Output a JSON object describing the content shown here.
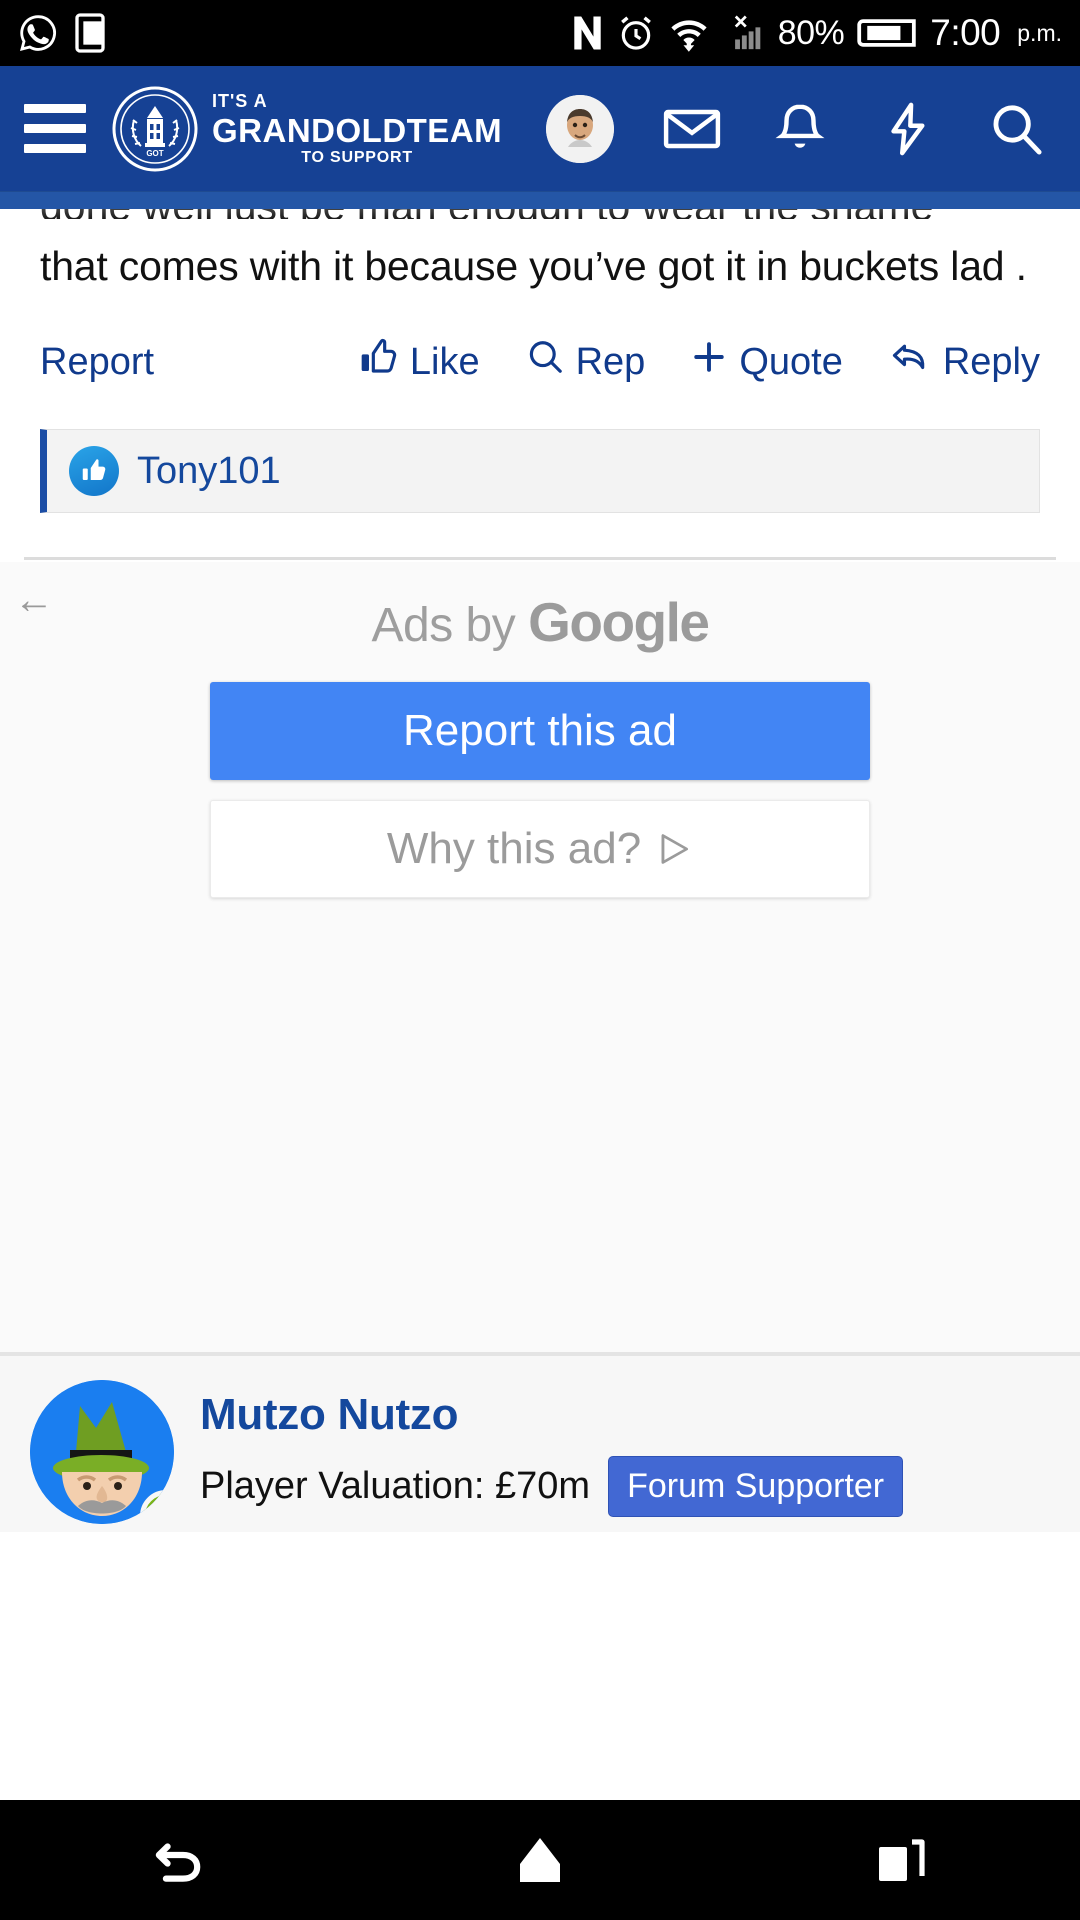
{
  "status_bar": {
    "left_icons": [
      "whatsapp-icon",
      "sim-card-icon"
    ],
    "right_icons": [
      "nfc-icon",
      "alarm-icon",
      "wifi-icon",
      "signal-icon"
    ],
    "battery_percent": "80%",
    "battery_icon": "battery-icon",
    "time": "7:00",
    "meridiem": "p.m."
  },
  "header": {
    "menu_icon": "hamburger-menu-icon",
    "logo_icon": "grandoldteam-badge-logo",
    "brand_line1": "IT'S A",
    "brand_line2": "GRANDOLDTEAM",
    "brand_line3": "TO SUPPORT",
    "avatar": "user-avatar",
    "icons": [
      "inbox-icon",
      "bell-icon",
      "lightning-icon",
      "search-icon"
    ]
  },
  "post": {
    "clipped_line": "done well just be man enough to wear the shame",
    "body": "that comes with it because you’ve got it in buckets lad .",
    "actions": {
      "report": "Report",
      "like": "Like",
      "rep": "Rep",
      "quote": "Quote",
      "reply": "Reply"
    },
    "likes": {
      "icon": "thumbs-up-icon",
      "user": "Tony101"
    }
  },
  "ad": {
    "back_icon": "back-arrow-icon",
    "label_prefix": "Ads by ",
    "label_brand": "Google",
    "report_button": "Report this ad",
    "why_button": "Why this ad?",
    "adchoices_icon": "adchoices-icon"
  },
  "next_post": {
    "avatar": "mutzo-nutzo-avatar",
    "username": "Mutzo Nutzo",
    "valuation": "Player Valuation: £70m",
    "badge": "Forum Supporter",
    "online_indicator": "online-status-dot"
  },
  "nav_bar": {
    "back": "back-nav-icon",
    "home": "home-nav-icon",
    "recents": "recents-nav-icon"
  },
  "colors": {
    "header_blue": "#164194",
    "link_blue": "#103a8c",
    "google_blue": "#4285f4",
    "badge_blue": "#4268d3"
  }
}
